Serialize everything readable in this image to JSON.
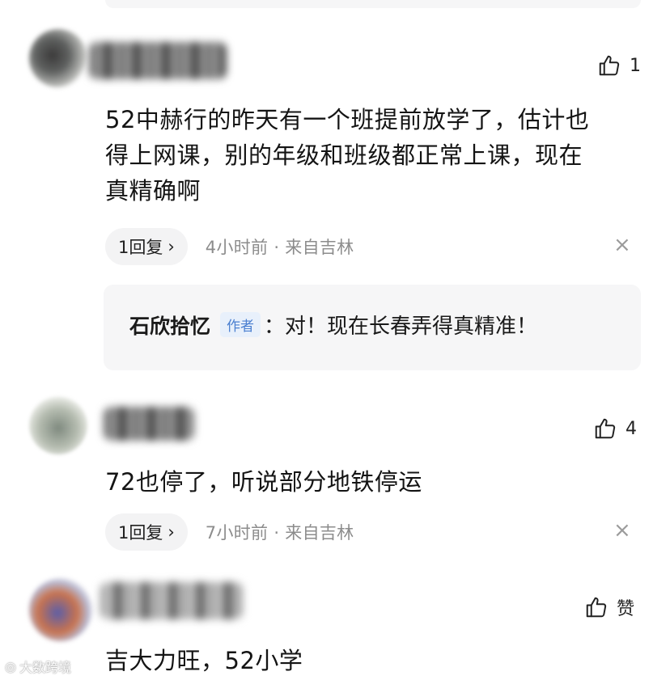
{
  "comments": [
    {
      "likes": "1",
      "text_lines": [
        "52中赫行的昨天有一个班提前放学了，估计也",
        "得上网课，别的年级和班级都正常上课，现在",
        "真精确啊"
      ],
      "reply_count": "1回复",
      "time_location": "4小时前 · 来自吉林",
      "close": "×",
      "reply": {
        "name": "石欣拾忆",
        "badge": "作者",
        "text": "：对！现在长春弄得真精准！"
      }
    },
    {
      "likes": "4",
      "text_lines": [
        "72也停了，听说部分地铁停运"
      ],
      "reply_count": "1回复",
      "time_location": "7小时前 · 来自吉林",
      "close": "×"
    },
    {
      "likes": "赞",
      "text_lines": [
        "吉大力旺，52小学"
      ]
    }
  ],
  "icons": {
    "like": "thumbs-up-icon",
    "chevron": "chevron-right-icon",
    "close": "close-icon"
  },
  "watermark": "大数跨境",
  "colors": {
    "meta": "#8c8c8c",
    "badge_text": "#4a7fd0",
    "badge_bg": "#e8f0fb",
    "card_bg": "#f6f6f7"
  }
}
